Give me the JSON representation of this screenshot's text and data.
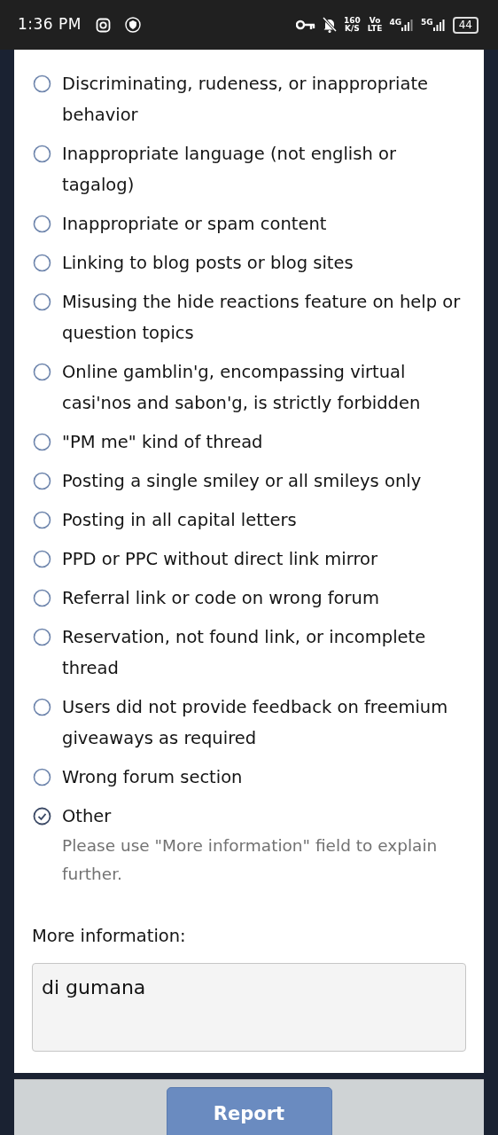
{
  "status_bar": {
    "time": "1:36 PM",
    "speed_value": "160",
    "speed_unit": "K/S",
    "volte_top": "Vo",
    "volte_bottom": "LTE",
    "network_1": "4G",
    "network_2": "5G",
    "battery": "44"
  },
  "reasons": [
    {
      "label": "Discriminating, rudeness, or inappropriate behavior",
      "selected": false
    },
    {
      "label": "Inappropriate language (not english or tagalog)",
      "selected": false
    },
    {
      "label": "Inappropriate or spam content",
      "selected": false
    },
    {
      "label": "Linking to blog posts or blog sites",
      "selected": false
    },
    {
      "label": "Misusing the hide reactions feature on help or question topics",
      "selected": false
    },
    {
      "label": "Online gamblin'g, encompassing virtual casi'nos and sabon'g, is strictly forbidden",
      "selected": false
    },
    {
      "label": "\"PM me\" kind of thread",
      "selected": false
    },
    {
      "label": "Posting a single smiley or all smileys only",
      "selected": false
    },
    {
      "label": "Posting in all capital letters",
      "selected": false
    },
    {
      "label": "PPD or PPC without direct link mirror",
      "selected": false
    },
    {
      "label": "Referral link or code on wrong forum",
      "selected": false
    },
    {
      "label": "Reservation, not found link, or incomplete thread",
      "selected": false
    },
    {
      "label": "Users did not provide feedback on freemium giveaways as required",
      "selected": false
    },
    {
      "label": "Wrong forum section",
      "selected": false
    },
    {
      "label": "Other",
      "selected": true,
      "hint": "Please use \"More information\" field to explain further."
    }
  ],
  "more_info": {
    "label": "More information:",
    "value": "di gumana"
  },
  "submit_button": "Report"
}
